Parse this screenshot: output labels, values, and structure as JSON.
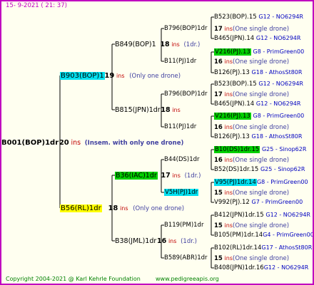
{
  "header": {
    "text": "15-  9-2021 (  21: 37)"
  },
  "footer": {
    "copyright": "Copyright 2004-2021 @ Karl Kehrle Foundation",
    "site": "www.pedigreeapis.org"
  },
  "root": {
    "name": "B001(BOP)1dr",
    "ins": "20",
    "ins_label": "ins",
    "note": "(Insem. with only one drone)"
  },
  "gen1": [
    {
      "name": "B903(BOP)1",
      "ins": "19",
      "ins_label": "ins",
      "note": "(Only one drone)"
    },
    {
      "name": "B56(RL)1dr",
      "ins": "18",
      "ins_label": "ins",
      "note": "(Only one drone)"
    }
  ],
  "gen2": [
    {
      "name": "B849(BOP)1",
      "ins": "18",
      "ins_label": "ins",
      "note": "(1dr.)"
    },
    {
      "name": "B815(JPN)1dr",
      "ins": "18",
      "ins_label": "ins"
    },
    {
      "name": "B36(IAC)1dr",
      "ins": "17",
      "ins_label": "ins",
      "note": "(1dr.)"
    },
    {
      "name": "B38(JML)1dr",
      "ins": "16",
      "ins_label": "ins",
      "note": "(1dr.)"
    }
  ],
  "gen3": [
    {
      "name": "B796(BOP)1dr",
      "ins": "17",
      "ins_label": "ins",
      "note": "(One single drone)"
    },
    {
      "name": "B11(PJ)1dr",
      "ins": "16",
      "ins_label": "ins",
      "note": "(One single drone)"
    },
    {
      "name": "B796(BOP)1dr",
      "ins": "17",
      "ins_label": "ins",
      "note": "(One single drone)"
    },
    {
      "name": "B11(PJ)1dr",
      "ins": "16",
      "ins_label": "ins",
      "note": "(One single drone)"
    },
    {
      "name": "B44(DS)1dr",
      "ins": "16",
      "ins_label": "ins",
      "note": "(One single drone)"
    },
    {
      "name": "V5H(PJ)1dr",
      "ins": "15",
      "ins_label": "ins",
      "note": "(One single drone)"
    },
    {
      "name": "B119(PM)1dr",
      "ins": "15",
      "ins_label": "ins",
      "note": "(One single drone)"
    },
    {
      "name": "B589(ABR)1dr",
      "ins": "15",
      "ins_label": "ins",
      "note": "(One single drone)"
    }
  ],
  "gen4": [
    {
      "name": "B523(BOP).15",
      "info": "G12 - NO6294R"
    },
    {
      "name": "B465(JPN).14",
      "info": "G12 - NO6294R"
    },
    {
      "name": "V216(PJ).13",
      "info": "G8 - PrimGreen00"
    },
    {
      "name": "B126(PJ).13",
      "info": "G18 - AthosSt80R"
    },
    {
      "name": "B523(BOP).15",
      "info": "G12 - NO6294R"
    },
    {
      "name": "B465(JPN).14",
      "info": "G12 - NO6294R"
    },
    {
      "name": "V216(PJ).13",
      "info": "G8 - PrimGreen00"
    },
    {
      "name": "B126(PJ).13",
      "info": "G18 - AthosSt80R"
    },
    {
      "name": "B10(DS)1dr.15",
      "info": "G25 - Sinop62R"
    },
    {
      "name": "B52(DS)1dr.15",
      "info": "G25 - Sinop62R"
    },
    {
      "name": "V95(PJ)1dr.14",
      "info": "G8 - PrimGreen00"
    },
    {
      "name": "V992(PJ).12",
      "info": "G7 - PrimGreen00"
    },
    {
      "name": "B412(JPN)1dr.15",
      "info": "G12 - NO6294R"
    },
    {
      "name": "B105(PM)1dr.14",
      "info": "G4 - PrimGreen00"
    },
    {
      "name": "B102(RL)1dr.14",
      "info": "G17 - AthosSt80R"
    },
    {
      "name": "B408(JPN)1dr.16",
      "info": "G12 - NO6294R"
    }
  ],
  "colors": {
    "frame": "#c000c0",
    "ins": "#c00000",
    "note": "#4040a0",
    "link": "#0000c0",
    "cyan": "#00e0f0",
    "green": "#00d000",
    "yellow": "#ffff00",
    "footer": "#008000"
  }
}
